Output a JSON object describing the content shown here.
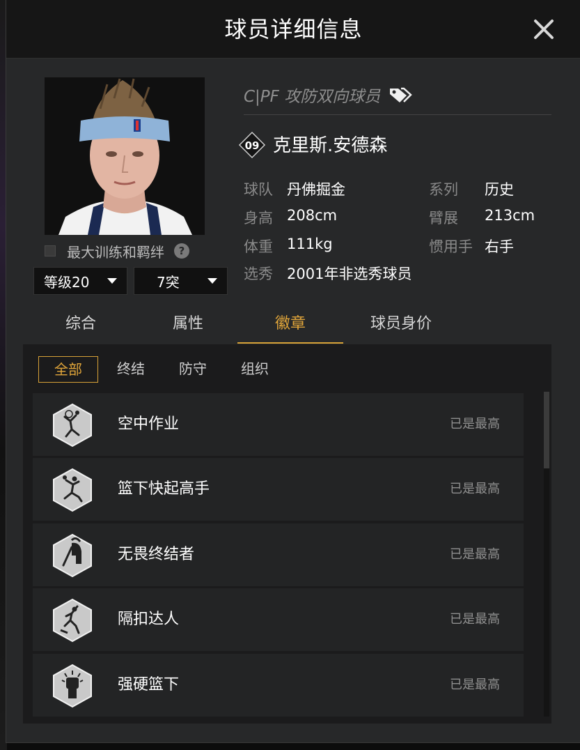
{
  "header": {
    "title": "球员详细信息"
  },
  "player": {
    "position_archetype": "C|PF 攻防双向球员",
    "jersey_number": "09",
    "name": "克里斯.安德森",
    "info": [
      {
        "label": "球队",
        "value": "丹佛掘金"
      },
      {
        "label": "系列",
        "value": "历史"
      },
      {
        "label": "身高",
        "value": "208cm"
      },
      {
        "label": "臂展",
        "value": "213cm"
      },
      {
        "label": "体重",
        "value": "111kg"
      },
      {
        "label": "惯用手",
        "value": "右手"
      },
      {
        "label": "选秀",
        "value": "2001年非选秀球员"
      }
    ]
  },
  "controls": {
    "max_training_label": "最大训练和羁绊",
    "help_icon": "?",
    "level_select": "等级20",
    "breakthrough_select": "7突"
  },
  "tabs": [
    {
      "label": "综合",
      "active": false
    },
    {
      "label": "属性",
      "active": false
    },
    {
      "label": "徽章",
      "active": true
    },
    {
      "label": "球员身价",
      "active": false
    }
  ],
  "subtabs": [
    {
      "label": "全部",
      "active": true
    },
    {
      "label": "终结",
      "active": false
    },
    {
      "label": "防守",
      "active": false
    },
    {
      "label": "组织",
      "active": false
    }
  ],
  "badges": [
    {
      "name": "空中作业",
      "status": "已是最高",
      "icon": "alley-oop-icon"
    },
    {
      "name": "篮下快起高手",
      "status": "已是最高",
      "icon": "putback-icon"
    },
    {
      "name": "无畏终结者",
      "status": "已是最高",
      "icon": "spartan-helmet-icon"
    },
    {
      "name": "隔扣达人",
      "status": "已是最高",
      "icon": "posterizer-icon"
    },
    {
      "name": "强硬篮下",
      "status": "已是最高",
      "icon": "fist-icon"
    }
  ],
  "colors": {
    "accent": "#d8a238",
    "panel": "#272829",
    "header": "#161616"
  }
}
